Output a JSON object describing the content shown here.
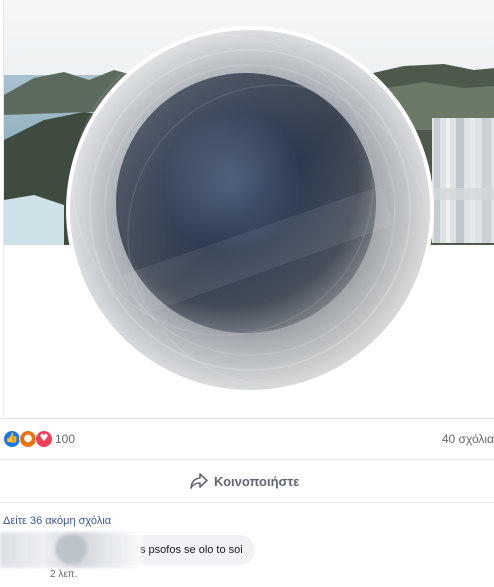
{
  "post": {
    "reactions": {
      "icons": [
        "like-icon",
        "angry-icon",
        "love-icon"
      ],
      "count": "100"
    },
    "comments_count_label": "40 σχόλια",
    "share_label": "Κοινοποιήστε",
    "more_comments_label": "Δείτε 36 ακόμη σχόλια",
    "comment": {
      "text": "s psofos se olo to soi",
      "time": "2 λεπ."
    }
  },
  "colors": {
    "like": "#1877f2",
    "angry": "#e9710f",
    "love": "#f33e58",
    "link": "#385898",
    "muted": "#65676b"
  }
}
